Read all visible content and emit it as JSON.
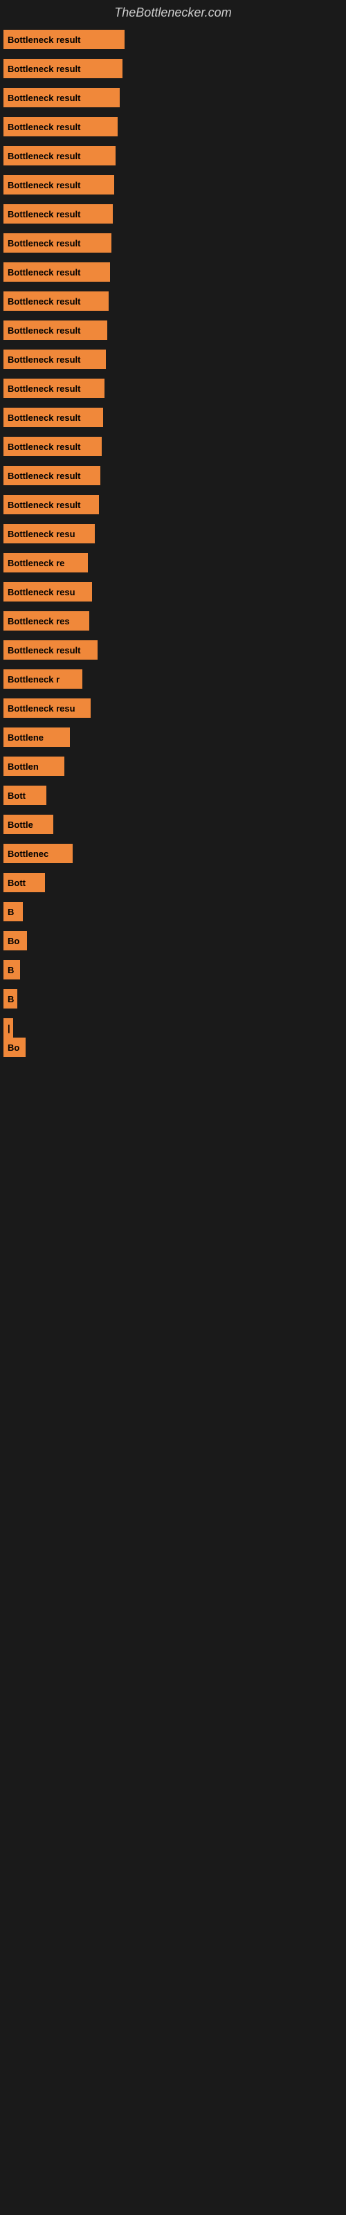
{
  "site": {
    "title": "TheBottlenecker.com"
  },
  "bars": [
    {
      "label": "Bottleneck result",
      "width": 175,
      "spacer": 14
    },
    {
      "label": "Bottleneck result",
      "width": 172,
      "spacer": 14
    },
    {
      "label": "Bottleneck result",
      "width": 168,
      "spacer": 14
    },
    {
      "label": "Bottleneck result",
      "width": 165,
      "spacer": 14
    },
    {
      "label": "Bottleneck result",
      "width": 162,
      "spacer": 14
    },
    {
      "label": "Bottleneck result",
      "width": 160,
      "spacer": 14
    },
    {
      "label": "Bottleneck result",
      "width": 158,
      "spacer": 14
    },
    {
      "label": "Bottleneck result",
      "width": 156,
      "spacer": 14
    },
    {
      "label": "Bottleneck result",
      "width": 154,
      "spacer": 14
    },
    {
      "label": "Bottleneck result",
      "width": 152,
      "spacer": 14
    },
    {
      "label": "Bottleneck result",
      "width": 150,
      "spacer": 14
    },
    {
      "label": "Bottleneck result",
      "width": 148,
      "spacer": 14
    },
    {
      "label": "Bottleneck result",
      "width": 146,
      "spacer": 14
    },
    {
      "label": "Bottleneck result",
      "width": 144,
      "spacer": 14
    },
    {
      "label": "Bottleneck result",
      "width": 142,
      "spacer": 14
    },
    {
      "label": "Bottleneck result",
      "width": 140,
      "spacer": 14
    },
    {
      "label": "Bottleneck result",
      "width": 138,
      "spacer": 14
    },
    {
      "label": "Bottleneck resu",
      "width": 132,
      "spacer": 14
    },
    {
      "label": "Bottleneck re",
      "width": 122,
      "spacer": 14
    },
    {
      "label": "Bottleneck resu",
      "width": 128,
      "spacer": 14
    },
    {
      "label": "Bottleneck res",
      "width": 124,
      "spacer": 14
    },
    {
      "label": "Bottleneck result",
      "width": 136,
      "spacer": 14
    },
    {
      "label": "Bottleneck r",
      "width": 114,
      "spacer": 14
    },
    {
      "label": "Bottleneck resu",
      "width": 126,
      "spacer": 14
    },
    {
      "label": "Bottlene",
      "width": 96,
      "spacer": 14
    },
    {
      "label": "Bottlen",
      "width": 88,
      "spacer": 14
    },
    {
      "label": "Bott",
      "width": 62,
      "spacer": 14
    },
    {
      "label": "Bottle",
      "width": 72,
      "spacer": 14
    },
    {
      "label": "Bottlenec",
      "width": 100,
      "spacer": 14
    },
    {
      "label": "Bott",
      "width": 60,
      "spacer": 14
    },
    {
      "label": "B",
      "width": 28,
      "spacer": 14
    },
    {
      "label": "Bo",
      "width": 34,
      "spacer": 14
    },
    {
      "label": "B",
      "width": 24,
      "spacer": 14
    },
    {
      "label": "B",
      "width": 20,
      "spacer": 14
    },
    {
      "label": "|",
      "width": 14,
      "spacer": 14
    },
    {
      "label": "Bo",
      "width": 32,
      "spacer": 0
    }
  ]
}
